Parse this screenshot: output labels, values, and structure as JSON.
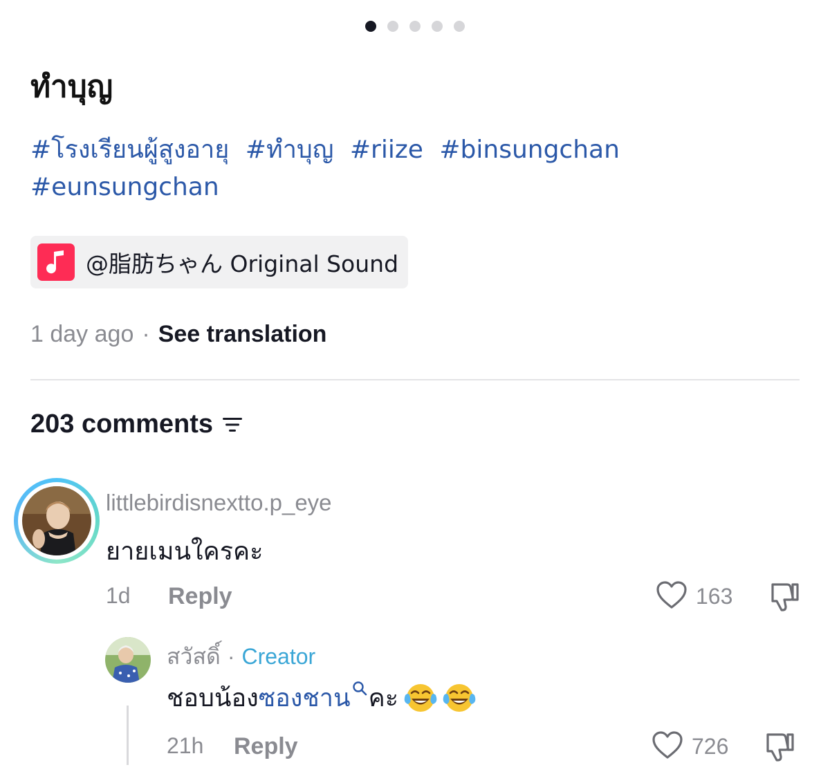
{
  "pager": {
    "total": 5,
    "active_index": 0
  },
  "post": {
    "title": "ทำบุญ",
    "hashtags": [
      "#โรงเรียนผู้สูงอายุ",
      "#ทำบุญ",
      "#riize",
      "#binsungchan",
      "#eunsungchan"
    ],
    "sound_label": "@脂肪ちゃん Original Sound",
    "time": "1 day ago",
    "separator": "·",
    "see_translation": "See translation"
  },
  "comments_section": {
    "count_label": "203 comments"
  },
  "comments": [
    {
      "username": "littlebirdisnextto.p_eye",
      "text": "ยายเมนใครคะ",
      "time": "1d",
      "reply_label": "Reply",
      "likes": "163"
    }
  ],
  "reply": {
    "username": "สวัสดิ์",
    "separator": "·",
    "badge": "Creator",
    "text_before": "ชอบน้อง",
    "text_link": "ซองชาน",
    "text_after": "คะ",
    "time": "21h",
    "reply_label": "Reply",
    "likes": "726"
  },
  "colors": {
    "hashtag": "#2b58a8",
    "sound_icon_bg": "#fe2c55",
    "creator_badge": "#3aa6d6",
    "muted": "#8a8b91",
    "text": "#161823"
  }
}
